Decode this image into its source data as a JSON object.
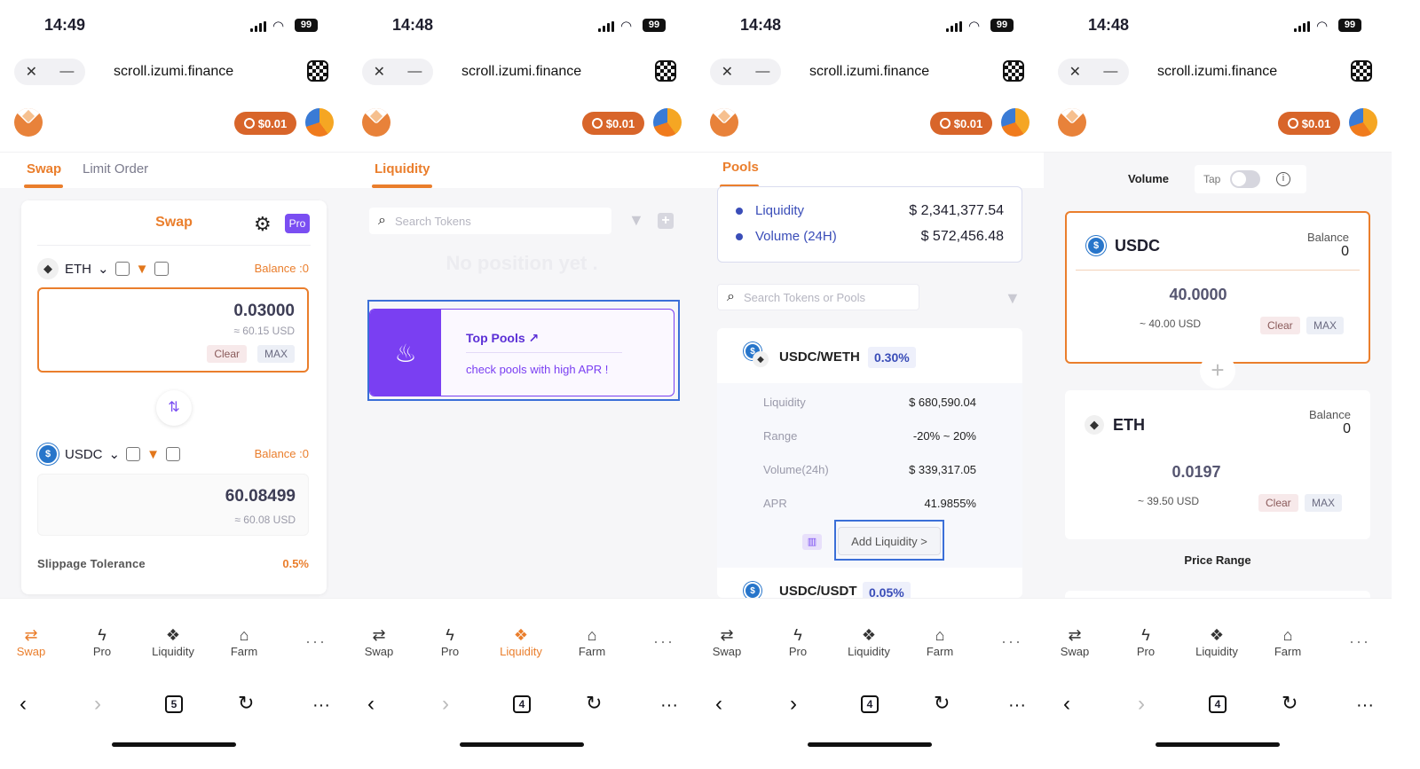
{
  "status_bar": {
    "times": [
      "14:49",
      "14:48",
      "14:48",
      "14:48"
    ],
    "battery": "99"
  },
  "browser": {
    "url": "scroll.izumi.finance",
    "close": "✕",
    "minimize": "—",
    "tab_counts": [
      "5",
      "4",
      "4",
      "4"
    ]
  },
  "header": {
    "price": "$0.01"
  },
  "nav": {
    "items": [
      "Swap",
      "Pro",
      "Liquidity",
      "Farm"
    ],
    "more": "···"
  },
  "screen1": {
    "tabs": [
      "Swap",
      "Limit Order"
    ],
    "card_title": "Swap",
    "pro_badge": "Pro",
    "from_token": {
      "symbol": "ETH",
      "balance": "Balance :0",
      "amount": "0.03000",
      "usd": "≈ 60.15 USD",
      "clear": "Clear",
      "max": "MAX"
    },
    "to_token": {
      "symbol": "USDC",
      "balance": "Balance :0",
      "amount": "60.08499",
      "usd": "≈ 60.08 USD"
    },
    "slippage_label": "Slippage Tolerance",
    "slippage_value": "0.5%"
  },
  "screen2": {
    "tab": "Liquidity",
    "search_placeholder": "Search Tokens",
    "empty_text": "No position yet .",
    "top_pools_title": "Top Pools",
    "top_pools_sub": "check pools with high APR !"
  },
  "screen3": {
    "tab": "Pools",
    "stats": [
      {
        "label": "Liquidity",
        "value": "$ 2,341,377.54"
      },
      {
        "label": "Volume (24H)",
        "value": "$ 572,456.48"
      }
    ],
    "search_placeholder": "Search Tokens or Pools",
    "pool": {
      "pair": "USDC/WETH",
      "fee": "0.30%",
      "rows": [
        {
          "k": "Liquidity",
          "v": "$ 680,590.04"
        },
        {
          "k": "Range",
          "v": "-20% ~ 20%"
        },
        {
          "k": "Volume(24h)",
          "v": "$ 339,317.05"
        },
        {
          "k": "APR",
          "v": "41.9855%"
        }
      ],
      "add_liquidity": "Add Liquidity >"
    },
    "pool2": {
      "pair": "USDC/USDT",
      "fee": "0.05%"
    }
  },
  "screen4": {
    "volume_label": "Volume",
    "tap_label": "Tap",
    "token_a": {
      "symbol": "USDC",
      "balance_label": "Balance",
      "balance": "0",
      "amount": "40.0000",
      "usd": "~ 40.00 USD",
      "clear": "Clear",
      "max": "MAX"
    },
    "token_b": {
      "symbol": "ETH",
      "balance_label": "Balance",
      "balance": "0",
      "amount": "0.0197",
      "usd": "~ 39.50 USD",
      "clear": "Clear",
      "max": "MAX"
    },
    "price_range": "Price Range"
  },
  "colors": {
    "accent": "#ea7e2c",
    "purple": "#7a3ff2",
    "blue": "#3a4db8"
  }
}
